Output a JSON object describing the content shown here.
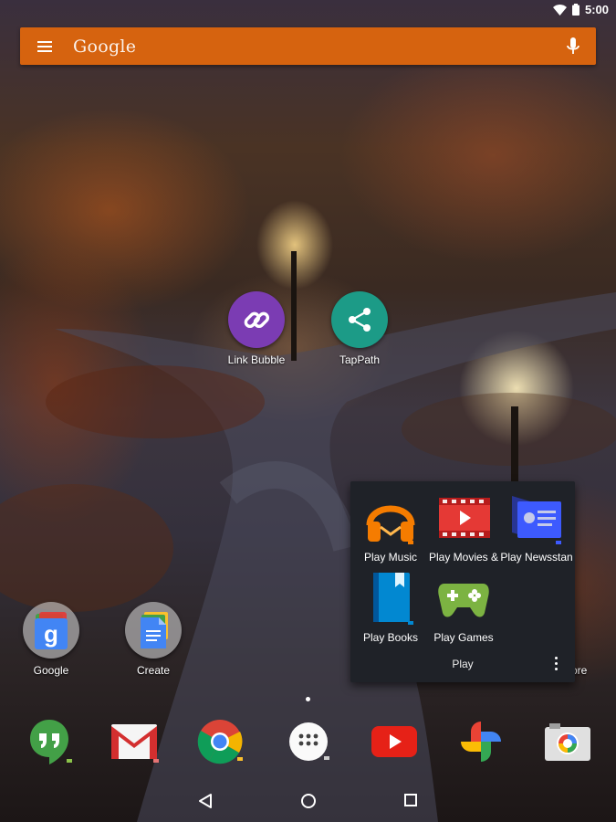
{
  "status_bar": {
    "time": "5:00"
  },
  "search_bar": {
    "logo_text": "Google"
  },
  "home_apps": [
    {
      "label": "Link Bubble",
      "icon": "link-icon",
      "color": "#7a3fb0"
    },
    {
      "label": "TapPath",
      "icon": "share-icon",
      "color": "#1b9a86"
    },
    {
      "label": "Google",
      "icon": "google-folder-icon"
    },
    {
      "label": "Create",
      "icon": "docs-folder-icon"
    }
  ],
  "folder": {
    "title": "Play",
    "items": [
      {
        "label": "Play Music",
        "icon": "headphones-icon",
        "color": "#f57c00"
      },
      {
        "label": "Play Movies &",
        "icon": "film-icon",
        "color": "#d32f2f"
      },
      {
        "label": "Play Newsstan",
        "icon": "newsstand-icon",
        "color": "#3d5afe"
      },
      {
        "label": "Play Books",
        "icon": "book-icon",
        "color": "#0288d1"
      },
      {
        "label": "Play Games",
        "icon": "gamepad-icon",
        "color": "#7cb342"
      }
    ],
    "partial_label_behind": "ore"
  },
  "dock": [
    {
      "name": "hangouts-icon",
      "color": "#43a047"
    },
    {
      "name": "gmail-icon",
      "color": "#d32f2f"
    },
    {
      "name": "chrome-icon",
      "color": "#1e88e5"
    },
    {
      "name": "app-drawer-icon",
      "color": "#ffffff"
    },
    {
      "name": "youtube-icon",
      "color": "#e62117"
    },
    {
      "name": "photos-icon",
      "color": "#fbbc05"
    },
    {
      "name": "camera-icon",
      "color": "#eeeeee"
    }
  ]
}
